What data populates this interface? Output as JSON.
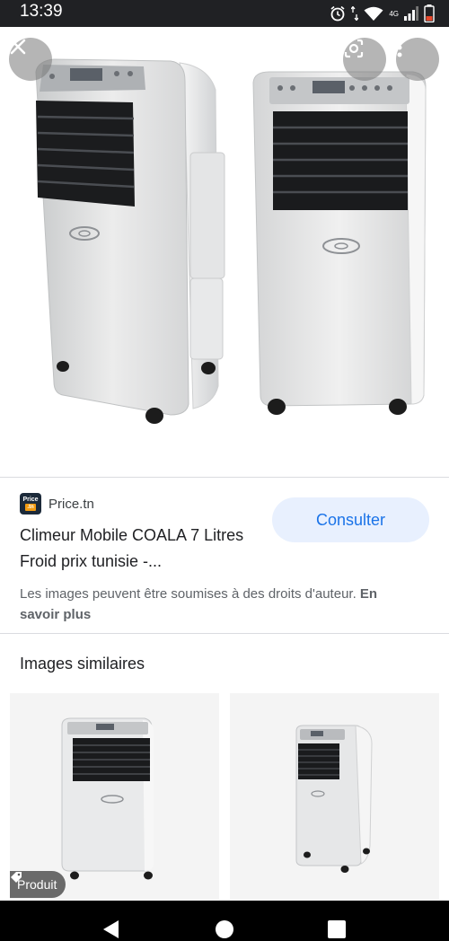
{
  "status_bar": {
    "time": "13:39",
    "network": "4G",
    "icons": [
      "alarm-icon",
      "data-arrows-icon",
      "wifi-icon",
      "signal-icon",
      "battery-icon"
    ]
  },
  "viewer": {
    "close_icon": "close-icon",
    "lens_icon": "lens-icon",
    "more_icon": "more-vert-icon"
  },
  "result": {
    "source_favicon_top": "Price",
    "source_favicon_bottom": ".tn",
    "source_name": "Price.tn",
    "title": "Climeur Mobile COALA 7 Litres Froid prix tunisie -...",
    "visit_button": "Consulter",
    "rights_text": "Les images peuvent être soumises à des droits d'auteur.",
    "learn_more": "En savoir plus"
  },
  "similar": {
    "heading": "Images similaires",
    "items": [
      {
        "badge": "Produit",
        "badge_icon": "tag-icon"
      },
      {
        "badge": ""
      }
    ]
  },
  "nav_bar": {
    "icons": [
      "back-icon",
      "home-icon",
      "recents-icon"
    ]
  },
  "colors": {
    "accent": "#1a73e8",
    "button_bg": "#e8f0fe",
    "status_bar": "#202124"
  }
}
